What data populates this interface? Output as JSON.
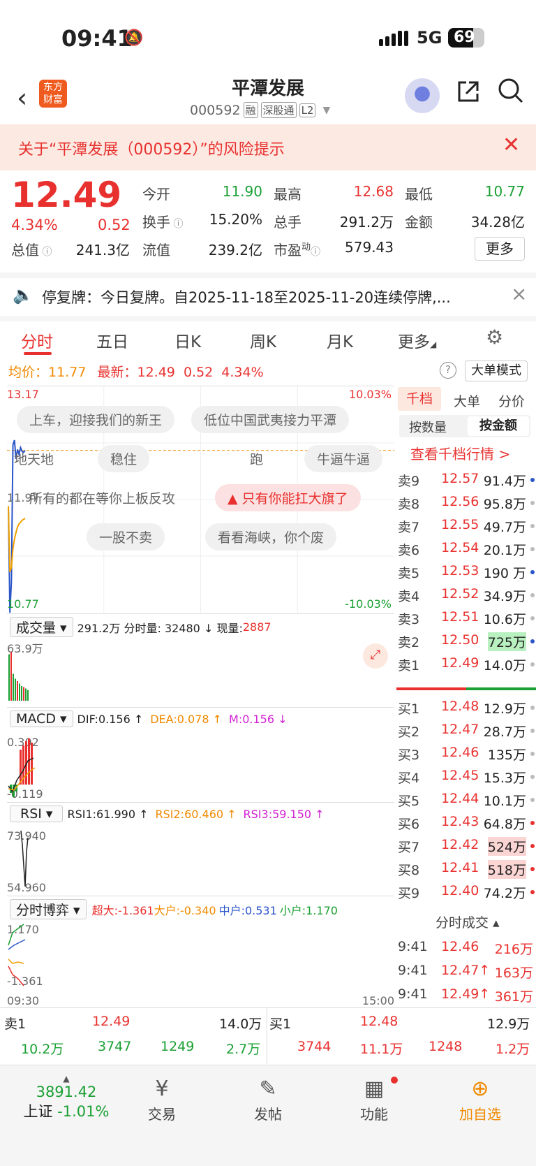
{
  "status": {
    "time": "09:41",
    "network": "5G",
    "battery": "69",
    "battery_level": 0.69
  },
  "header": {
    "title": "平潭发展",
    "code": "000592",
    "tags": [
      "融",
      "深股通",
      "L2"
    ],
    "logo_line1": "东方",
    "logo_line2": "财富"
  },
  "risk": {
    "text": "关于“平潭发展（000592）”的风险提示"
  },
  "quote": {
    "price": "12.49",
    "pct": "4.34%",
    "change": "0.52",
    "open_label": "今开",
    "open": "11.90",
    "high_label": "最高",
    "high": "12.68",
    "low_label": "最低",
    "low": "10.77",
    "turnover_label": "换手",
    "turnover": "15.20%",
    "volume_label": "总手",
    "volume": "291.2万",
    "amount_label": "金额",
    "amount": "34.28亿",
    "mktcap_label": "总值",
    "mktcap": "241.3亿",
    "float_label": "流值",
    "float": "239.2亿",
    "pe_label": "市盈",
    "pe_sup": "动",
    "pe": "579.43",
    "more": "更多"
  },
  "notice": {
    "text": "停复牌：今日复牌。自2025-11-18至2025-11-20连续停牌,..."
  },
  "tabs": [
    "分时",
    "五日",
    "日K",
    "周K",
    "月K",
    "更多"
  ],
  "avg": {
    "avg_label": "均价：",
    "avg": "11.77",
    "latest_label": "最新：",
    "latest": "12.49",
    "chg": "0.52",
    "pct": "4.34%",
    "mode": "大单模式",
    "help": "?"
  },
  "chart": {
    "top_price": "13.17",
    "bottom_price": "10.77",
    "top_pct": "10.03%",
    "bottom_pct": "-10.03%",
    "mid_price": "11.97",
    "start_time": "09:30",
    "end_time": "15:00",
    "bubbles": [
      "上车，迎接我们的新王",
      "低位中国武夷接力平潭",
      "地天地",
      "稳住",
      "跑",
      "牛逼牛逼",
      "所有的都在等你上板反攻",
      "只有你能扛大旗了",
      "一股不卖",
      "看看海峡，你个废"
    ]
  },
  "chart_data": {
    "type": "line",
    "x": [
      "09:30",
      "09:31",
      "09:32",
      "09:33",
      "09:34",
      "09:35",
      "09:36",
      "09:37",
      "09:38",
      "09:39",
      "09:40",
      "09:41"
    ],
    "series": [
      {
        "values": [
          11.9,
          10.77,
          11.1,
          12.55,
          12.6,
          12.4,
          12.5,
          12.45,
          12.52,
          12.48,
          12.47,
          12.49
        ]
      },
      {
        "values": [
          11.9,
          11.2,
          11.25,
          11.45,
          11.55,
          11.62,
          11.68,
          11.71,
          11.73,
          11.75,
          11.76,
          11.77
        ]
      }
    ],
    "ylim": [
      10.77,
      13.17
    ]
  },
  "volume": {
    "label": "成交量",
    "text": "291.2万 分时量: 32480 ↓ 现量: ",
    "now": "2887",
    "max": "63.9万",
    "bars": [
      0.95,
      1.0,
      0.55,
      0.45,
      0.4,
      0.35,
      0.3,
      0.28,
      0.25,
      0.22
    ]
  },
  "macd": {
    "label": "MACD",
    "dif": "DIF:0.156 ↑",
    "dea": "DEA:0.078 ↑",
    "m": "M:0.156 ↓",
    "top": "0.302",
    "bottom": "-0.119"
  },
  "rsi": {
    "label": "RSI",
    "r1": "RSI1:61.990 ↑",
    "r2": "RSI2:60.460 ↑",
    "r3": "RSI3:59.150 ↑",
    "top": "73.940",
    "bottom": "54.960"
  },
  "game": {
    "label": "分时博弈",
    "big": "超大:-1.361",
    "large": "大户:-0.340",
    "mid": "中户:0.531",
    "small": "小户:1.170",
    "top": "1.170",
    "bottom": "-1.361"
  },
  "book": {
    "tabs": [
      "千档",
      "大单",
      "分价"
    ],
    "modes": [
      "按数量",
      "按金额"
    ],
    "link": "查看千档行情 >",
    "asks": [
      {
        "l": "卖9",
        "p": "12.57",
        "v": "91.4万",
        "c": "#2a55c9"
      },
      {
        "l": "卖8",
        "p": "12.56",
        "v": "95.8万",
        "c": "#bbbbbb"
      },
      {
        "l": "卖7",
        "p": "12.55",
        "v": "49.7万",
        "c": "#bbbbbb"
      },
      {
        "l": "卖6",
        "p": "12.54",
        "v": "20.1万",
        "c": "#bbbbbb"
      },
      {
        "l": "卖5",
        "p": "12.53",
        "v": "190 万",
        "c": "#2a55c9"
      },
      {
        "l": "卖4",
        "p": "12.52",
        "v": "34.9万",
        "c": "#bbbbbb"
      },
      {
        "l": "卖3",
        "p": "12.51",
        "v": "10.6万",
        "c": "#bbbbbb"
      },
      {
        "l": "卖2",
        "p": "12.50",
        "v": "725万",
        "c": "#2a55c9"
      },
      {
        "l": "卖1",
        "p": "12.49",
        "v": "14.0万",
        "c": "#bbbbbb"
      }
    ],
    "bids": [
      {
        "l": "买1",
        "p": "12.48",
        "v": "12.9万",
        "c": "#bbbbbb"
      },
      {
        "l": "买2",
        "p": "12.47",
        "v": "28.7万",
        "c": "#bbbbbb"
      },
      {
        "l": "买3",
        "p": "12.46",
        "v": "135万",
        "c": "#bbbbbb"
      },
      {
        "l": "买4",
        "p": "12.45",
        "v": "15.3万",
        "c": "#bbbbbb"
      },
      {
        "l": "买5",
        "p": "12.44",
        "v": "10.1万",
        "c": "#bbbbbb"
      },
      {
        "l": "买6",
        "p": "12.43",
        "v": "64.8万",
        "c": "#e8312f"
      },
      {
        "l": "买7",
        "p": "12.42",
        "v": "524万",
        "c": "#e8312f"
      },
      {
        "l": "买8",
        "p": "12.41",
        "v": "518万",
        "c": "#e8312f"
      },
      {
        "l": "买9",
        "p": "12.40",
        "v": "74.2万",
        "c": "#e8312f"
      }
    ],
    "ticks_label": "分时成交",
    "ticks": [
      {
        "t": "9:41",
        "p": "12.46",
        "v": "216万"
      },
      {
        "t": "9:41",
        "p": "12.47↑",
        "v": "163万"
      },
      {
        "t": "9:41",
        "p": "12.49↑",
        "v": "361万"
      }
    ]
  },
  "summary": {
    "s1_label": "卖1",
    "s1_price": "12.49",
    "s1_vol": "14.0万",
    "b1_label": "买1",
    "b1_price": "12.48",
    "b1_vol": "12.9万",
    "row2": [
      "10.2万",
      "3747",
      "1249",
      "2.7万",
      "3744",
      "11.1万",
      "1248",
      "1.2万"
    ]
  },
  "nav": {
    "index_value": "3891.42",
    "index_name": "上证",
    "index_pct": "-1.01%",
    "items": [
      "交易",
      "发帖",
      "功能",
      "加自选"
    ]
  }
}
